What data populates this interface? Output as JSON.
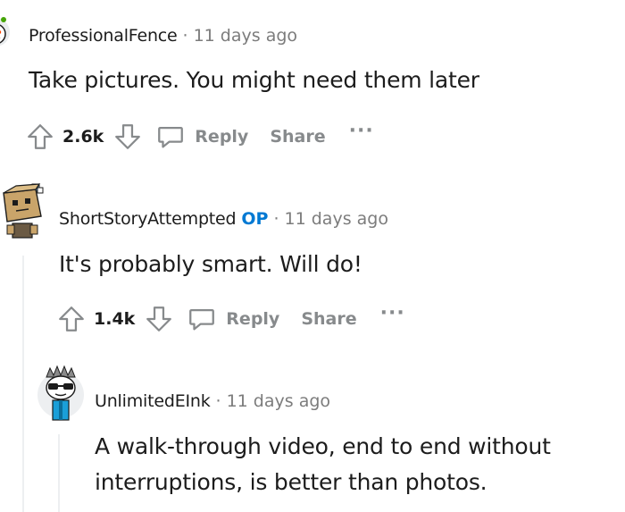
{
  "comments": [
    {
      "username": "ProfessionalFence",
      "op_badge": "",
      "separator": "·",
      "time": "11 days ago",
      "body": [
        "Take pictures. You might need them later"
      ],
      "score": "2.6k",
      "reply_label": "Reply",
      "share_label": "Share",
      "more_label": "···",
      "avatar_icon": "snoo-avatar-icon"
    },
    {
      "username": "ShortStoryAttempted",
      "op_badge": "OP",
      "separator": "·",
      "time": "11 days ago",
      "body": [
        "It's probably smart. Will do!"
      ],
      "score": "1.4k",
      "reply_label": "Reply",
      "share_label": "Share",
      "more_label": "···",
      "avatar_icon": "box-robot-avatar-icon"
    },
    {
      "username": "UnlimitedEInk",
      "op_badge": "",
      "separator": "·",
      "time": "11 days ago",
      "body": [
        "A walk-through video, end to end without",
        "interruptions, is better than photos."
      ],
      "avatar_icon": "sunglasses-snoo-avatar-icon"
    }
  ],
  "colors": {
    "text": "#1c1c1c",
    "muted": "#7c7c7c",
    "action": "#878a8c",
    "op": "#0079d3",
    "thread_line": "#edeff1"
  },
  "icons": [
    "upvote-icon",
    "downvote-icon",
    "comment-bubble-icon",
    "more-dots-icon"
  ]
}
